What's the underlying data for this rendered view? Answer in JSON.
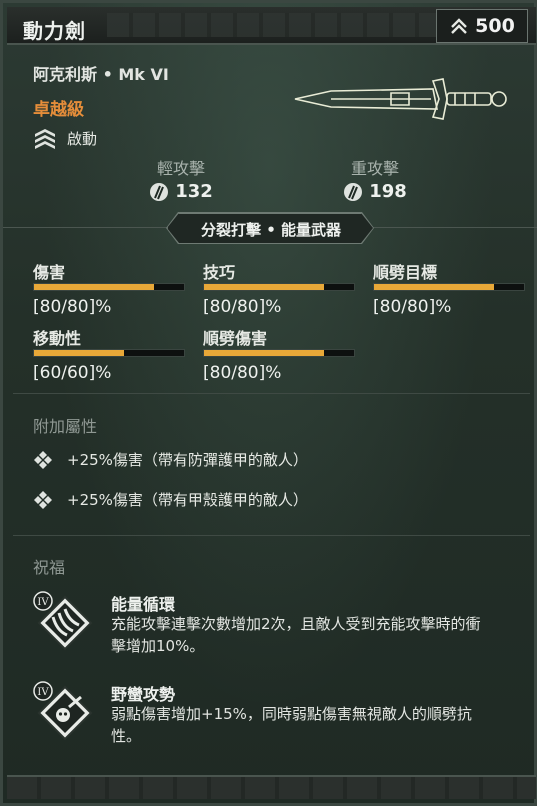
{
  "header": {
    "weapon_name": "動力劍",
    "power_icon": "chevron-up-icon",
    "power_value": "500"
  },
  "item": {
    "subtitle": "阿克利斯 • Mk VI",
    "rarity": "卓越級",
    "rarity_color": "#e58d3a",
    "activate_icon": "stacked-chevrons-icon",
    "activate_label": "啟動"
  },
  "attacks": {
    "light": {
      "label": "輕攻擊",
      "value": "132"
    },
    "heavy": {
      "label": "重攻擊",
      "value": "198"
    }
  },
  "traits": "分裂打擊 • 能量武器",
  "stats": [
    {
      "name": "傷害",
      "value": "[80/80]%",
      "fill": 0.8
    },
    {
      "name": "技巧",
      "value": "[80/80]%",
      "fill": 0.8
    },
    {
      "name": "順劈目標",
      "value": "[80/80]%",
      "fill": 0.8
    },
    {
      "name": "移動性",
      "value": "[60/60]%",
      "fill": 0.6
    },
    {
      "name": "順劈傷害",
      "value": "[80/80]%",
      "fill": 0.8
    }
  ],
  "bonus": {
    "title": "附加屬性",
    "perks": [
      "+25%傷害（帶有防彈護甲的敵人）",
      "+25%傷害（帶有甲殼護甲的敵人）"
    ]
  },
  "blessings": {
    "title": "祝福",
    "items": [
      {
        "tier": "IV",
        "name": "能量循環",
        "desc": "充能攻擊連擊次數增加2次，且敵人受到充能攻擊時的衝擊增加10%。"
      },
      {
        "tier": "IV",
        "name": "野蠻攻勢",
        "desc": "弱點傷害增加+15%，同時弱點傷害無視敵人的順劈抗性。"
      }
    ]
  },
  "colors": {
    "accent_bar": "#e8a838",
    "panel": "#243029"
  }
}
